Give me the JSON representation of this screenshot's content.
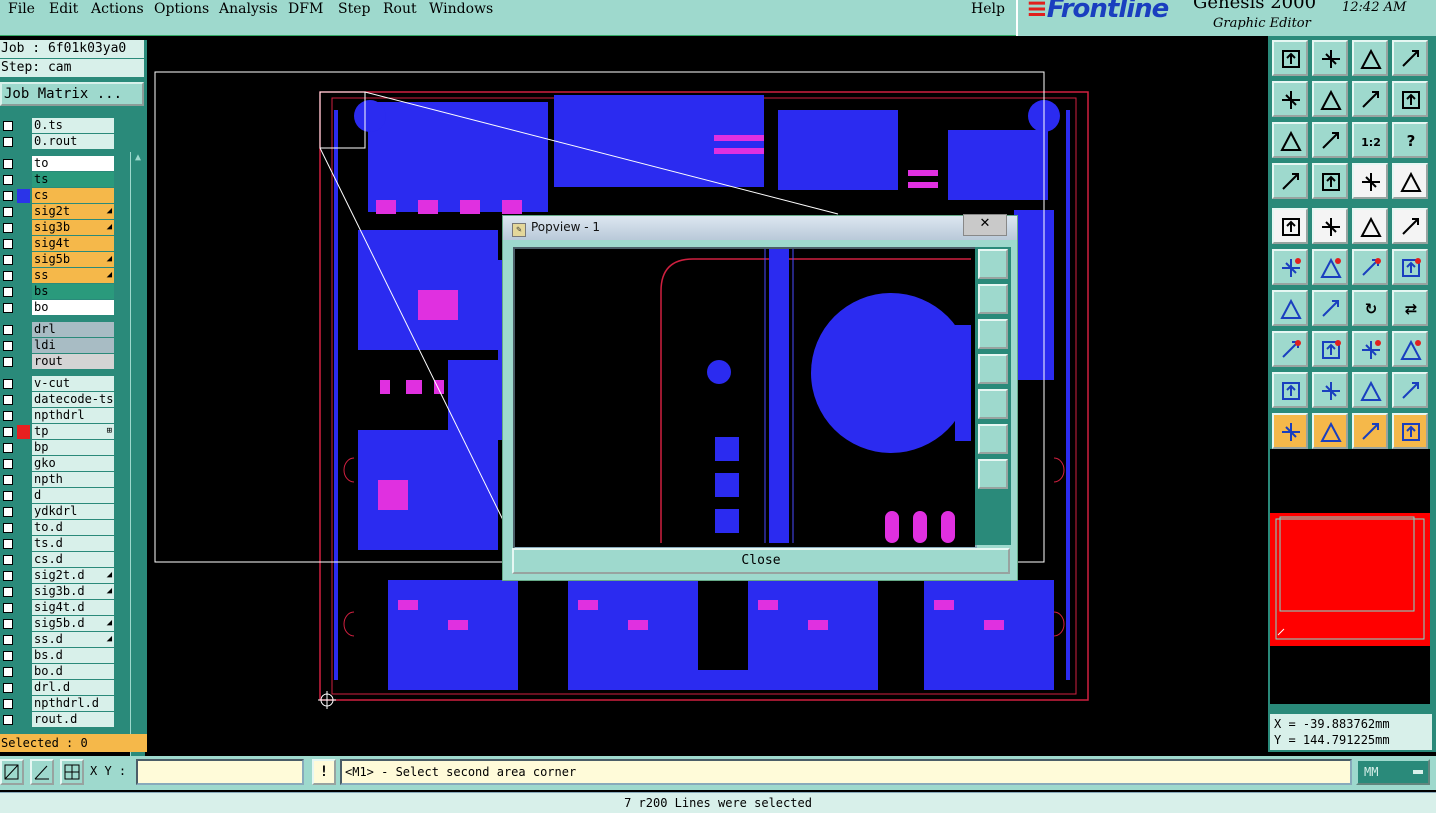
{
  "menu": {
    "items": [
      "File",
      "Edit",
      "Actions",
      "Options",
      "Analysis",
      "DFM",
      "Step",
      "Rout",
      "Windows"
    ],
    "help": "Help"
  },
  "brand": {
    "logo": "Frontline",
    "product": "Genesis 2000",
    "subtitle": "Graphic Editor",
    "clock": "12:42 AM"
  },
  "job": {
    "job_line": "Job : 6f01k03ya0",
    "step_line": "Step: cam",
    "matrix_button": "Job Matrix ..."
  },
  "layers": [
    {
      "name": "0.ts",
      "color": "#d8f0ea",
      "swatch": ""
    },
    {
      "name": "0.rout",
      "color": "#d8f0ea",
      "swatch": ""
    },
    {
      "name": "to",
      "color": "#ffffff",
      "swatch": ""
    },
    {
      "name": "ts",
      "color": "#2a9a7c",
      "swatch": ""
    },
    {
      "name": "cs",
      "color": "#f5b84a",
      "swatch": "#2b34e8"
    },
    {
      "name": "sig2t",
      "color": "#f5b84a",
      "swatch": "",
      "mark": "◢"
    },
    {
      "name": "sig3b",
      "color": "#f5b84a",
      "swatch": "",
      "mark": "◢"
    },
    {
      "name": "sig4t",
      "color": "#f5b84a",
      "swatch": ""
    },
    {
      "name": "sig5b",
      "color": "#f5b84a",
      "swatch": "",
      "mark": "◢"
    },
    {
      "name": "ss",
      "color": "#f5b84a",
      "swatch": "",
      "mark": "◢"
    },
    {
      "name": "bs",
      "color": "#2a9a7c",
      "swatch": ""
    },
    {
      "name": "bo",
      "color": "#ffffff",
      "swatch": ""
    },
    {
      "name": "drl",
      "color": "#a8bcc4",
      "swatch": ""
    },
    {
      "name": "ldi",
      "color": "#a8bcc4",
      "swatch": ""
    },
    {
      "name": "rout",
      "color": "#d4d4d4",
      "swatch": ""
    },
    {
      "name": "v-cut",
      "color": "#d8f0ea",
      "swatch": ""
    },
    {
      "name": "datecode-ts",
      "color": "#d8f0ea",
      "swatch": ""
    },
    {
      "name": "npthdrl",
      "color": "#d8f0ea",
      "swatch": ""
    },
    {
      "name": "tp",
      "color": "#d8f0ea",
      "swatch": "#e82020",
      "mark": "⊞"
    },
    {
      "name": "bp",
      "color": "#d8f0ea",
      "swatch": ""
    },
    {
      "name": "gko",
      "color": "#d8f0ea",
      "swatch": ""
    },
    {
      "name": "npth",
      "color": "#d8f0ea",
      "swatch": ""
    },
    {
      "name": "d",
      "color": "#d8f0ea",
      "swatch": ""
    },
    {
      "name": "ydkdrl",
      "color": "#d8f0ea",
      "swatch": ""
    },
    {
      "name": "to.d",
      "color": "#d8f0ea",
      "swatch": ""
    },
    {
      "name": "ts.d",
      "color": "#d8f0ea",
      "swatch": ""
    },
    {
      "name": "cs.d",
      "color": "#d8f0ea",
      "swatch": ""
    },
    {
      "name": "sig2t.d",
      "color": "#d8f0ea",
      "swatch": "",
      "mark": "◢"
    },
    {
      "name": "sig3b.d",
      "color": "#d8f0ea",
      "swatch": "",
      "mark": "◢"
    },
    {
      "name": "sig4t.d",
      "color": "#d8f0ea",
      "swatch": ""
    },
    {
      "name": "sig5b.d",
      "color": "#d8f0ea",
      "swatch": "",
      "mark": "◢"
    },
    {
      "name": "ss.d",
      "color": "#d8f0ea",
      "swatch": "",
      "mark": "◢"
    },
    {
      "name": "bs.d",
      "color": "#d8f0ea",
      "swatch": ""
    },
    {
      "name": "bo.d",
      "color": "#d8f0ea",
      "swatch": ""
    },
    {
      "name": "drl.d",
      "color": "#d8f0ea",
      "swatch": ""
    },
    {
      "name": "npthdrl.d",
      "color": "#d8f0ea",
      "swatch": ""
    },
    {
      "name": "rout.d",
      "color": "#d8f0ea",
      "swatch": ""
    }
  ],
  "selected": "Selected : 0",
  "popview": {
    "title": "Popview - 1",
    "close_label": "Close",
    "close_x": "✕"
  },
  "coords": {
    "x": "X = -39.883762mm",
    "y": "Y = 144.791225mm"
  },
  "bottom": {
    "xy_label": "X Y :",
    "xy_value": "",
    "prompt_icon": "!",
    "prompt": "<M1> - Select second area corner",
    "units": "MM"
  },
  "status": "7 r200 Lines were selected",
  "colors": {
    "panel": "#9ed9cd",
    "dark_panel": "#2a8a7a",
    "copper": "#2b2bf0",
    "pad": "#e030e0",
    "outline": "#d02040"
  }
}
